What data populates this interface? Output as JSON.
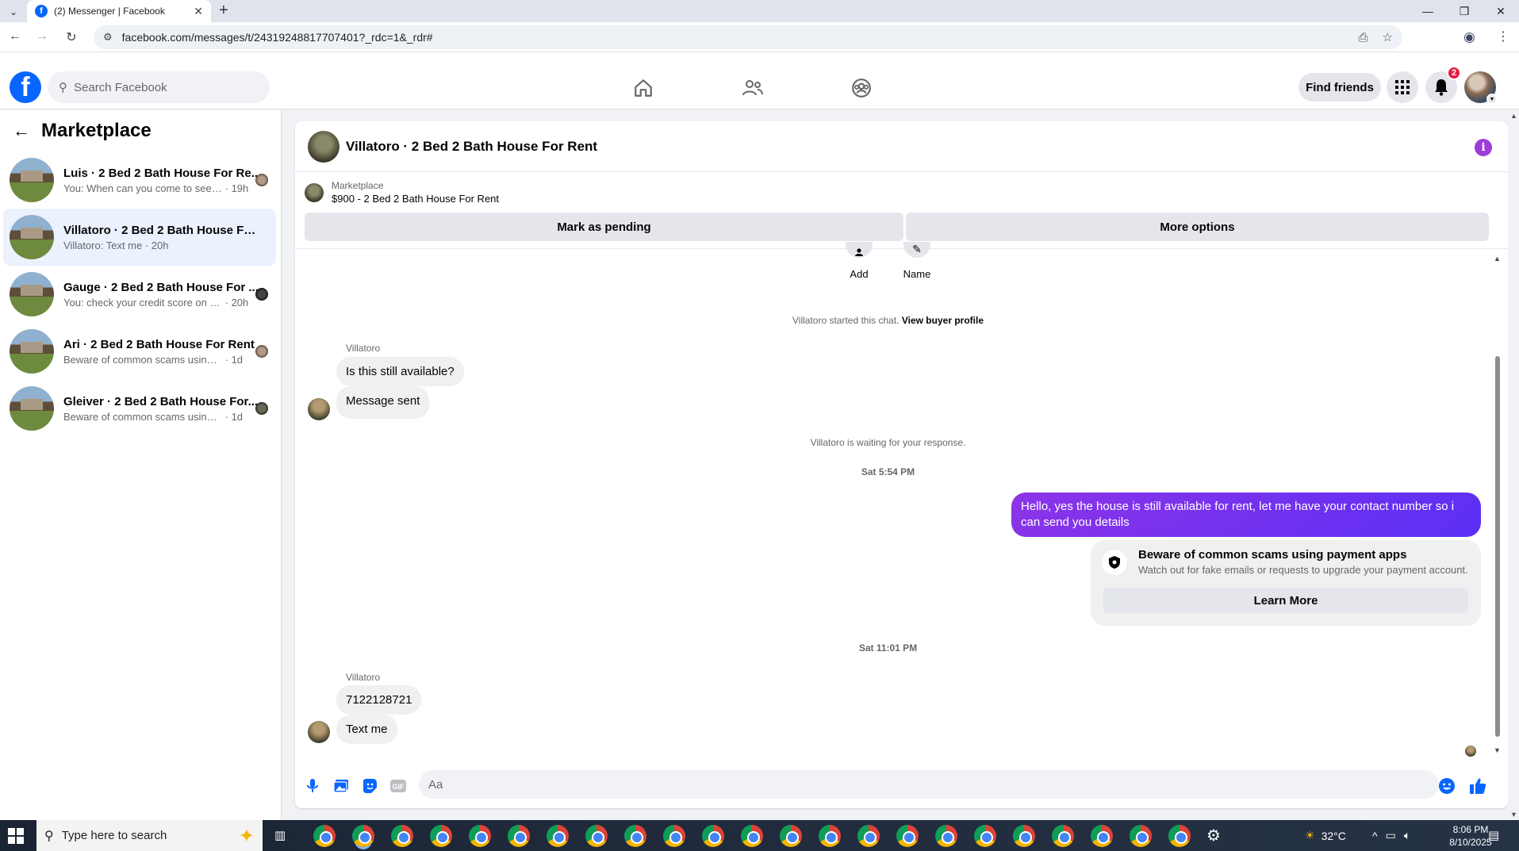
{
  "browser": {
    "tab_title": "(2) Messenger | Facebook",
    "url": "facebook.com/messages/t/24319248817707401?_rdc=1&_rdr#"
  },
  "fb": {
    "search_placeholder": "Search Facebook",
    "find_friends": "Find friends",
    "notification_count": "2"
  },
  "sidebar": {
    "title": "Marketplace",
    "conversations": [
      {
        "name": "Luis · 2 Bed 2 Bath House For Re...",
        "preview": "You: When can you come to see t...",
        "time": "· 19h",
        "active": false
      },
      {
        "name": "Villatoro · 2 Bed 2 Bath House For ...",
        "preview": "Villatoro: Text me",
        "time": "· 20h",
        "active": true
      },
      {
        "name": "Gauge · 2 Bed 2 Bath House For ...",
        "preview": "You: check your credit score on th...",
        "time": "· 20h",
        "active": false
      },
      {
        "name": "Ari · 2 Bed 2 Bath House For Rent",
        "preview": "Beware of common scams using p...",
        "time": "· 1d",
        "active": false
      },
      {
        "name": "Gleiver · 2 Bed 2 Bath House For...",
        "preview": "Beware of common scams using p...",
        "time": "· 1d",
        "active": false
      }
    ]
  },
  "chat": {
    "title": "Villatoro · 2 Bed 2 Bath House For Rent",
    "listing_source": "Marketplace",
    "listing_detail": "$900 - 2 Bed 2 Bath House For Rent",
    "mark_pending": "Mark as pending",
    "more_options": "More options",
    "quick_add": "Add",
    "quick_name": "Name",
    "started_text": "Villatoro started this chat.",
    "view_profile": "View buyer profile",
    "sender1": "Villatoro",
    "msg1": "Is this still available?",
    "msg2": "Message sent",
    "waiting": "Villatoro is waiting for your response.",
    "time1": "Sat 5:54 PM",
    "outgoing": "Hello, yes the house is still available for rent, let me have your contact number so i can send you  details",
    "scam_title": "Beware of common scams using payment apps",
    "scam_desc": "Watch out for fake emails or requests to upgrade your payment account.",
    "learn_more": "Learn More",
    "time2": "Sat 11:01 PM",
    "sender2": "Villatoro",
    "msg3": "7122128721",
    "msg4": "Text me",
    "composer_placeholder": "Aa"
  },
  "taskbar": {
    "search_placeholder": "Type here to search",
    "temperature": "32°C",
    "time": "8:06 PM",
    "date": "8/10/2025"
  },
  "colors": {
    "fb_blue": "#0866ff",
    "outgoing_bubble": "#7b2ff2",
    "active_conversation": "#ebf2fe",
    "badge_red": "#e41e3f"
  }
}
